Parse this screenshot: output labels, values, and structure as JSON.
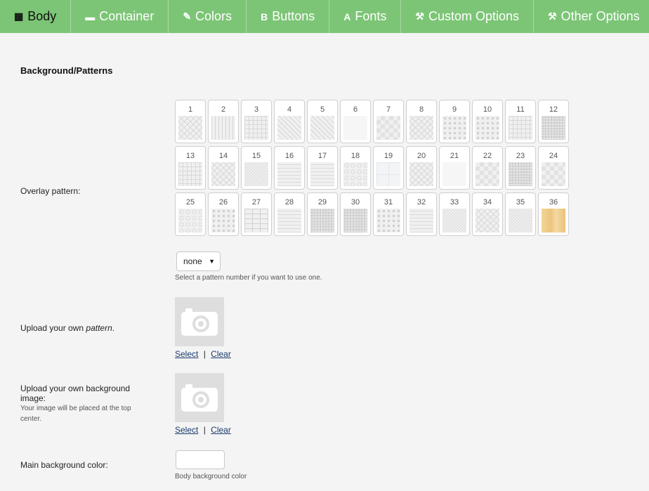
{
  "tabs": [
    {
      "label": "Body",
      "icon": "layout-icon",
      "glyph": "▦"
    },
    {
      "label": "Container",
      "icon": "container-icon",
      "glyph": "▬"
    },
    {
      "label": "Colors",
      "icon": "edit-icon",
      "glyph": "✎"
    },
    {
      "label": "Buttons",
      "icon": "bold-icon",
      "glyph": "B"
    },
    {
      "label": "Fonts",
      "icon": "font-icon",
      "glyph": "A"
    },
    {
      "label": "Custom Options",
      "icon": "tools-icon",
      "glyph": "⚒"
    },
    {
      "label": "Other Options",
      "icon": "tools-icon",
      "glyph": "⚒"
    }
  ],
  "colors": {
    "tab_bg": "#7cc576",
    "page_bg": "#f4f4f4",
    "link": "#1a3a6b"
  },
  "section_title": "Background/Patterns",
  "overlay": {
    "label": "Overlay pattern:",
    "patterns": [
      "1",
      "2",
      "3",
      "4",
      "5",
      "6",
      "7",
      "8",
      "9",
      "10",
      "11",
      "12",
      "13",
      "14",
      "15",
      "16",
      "17",
      "18",
      "19",
      "20",
      "21",
      "22",
      "23",
      "24",
      "25",
      "26",
      "27",
      "28",
      "29",
      "30",
      "31",
      "32",
      "33",
      "34",
      "35",
      "36"
    ],
    "select_value": "none",
    "help": "Select a pattern number if you want to use one."
  },
  "upload_pattern": {
    "label_prefix": "Upload your own ",
    "label_emph": "pattern",
    "label_suffix": ".",
    "select_link": "Select",
    "separator": "|",
    "clear_link": "Clear"
  },
  "upload_background": {
    "label": "Upload your own background image:",
    "sublabel": "Your image will be placed at the top center.",
    "select_link": "Select",
    "separator": "|",
    "clear_link": "Clear"
  },
  "main_bg_color": {
    "label": "Main background color:",
    "help": "Body background color"
  }
}
